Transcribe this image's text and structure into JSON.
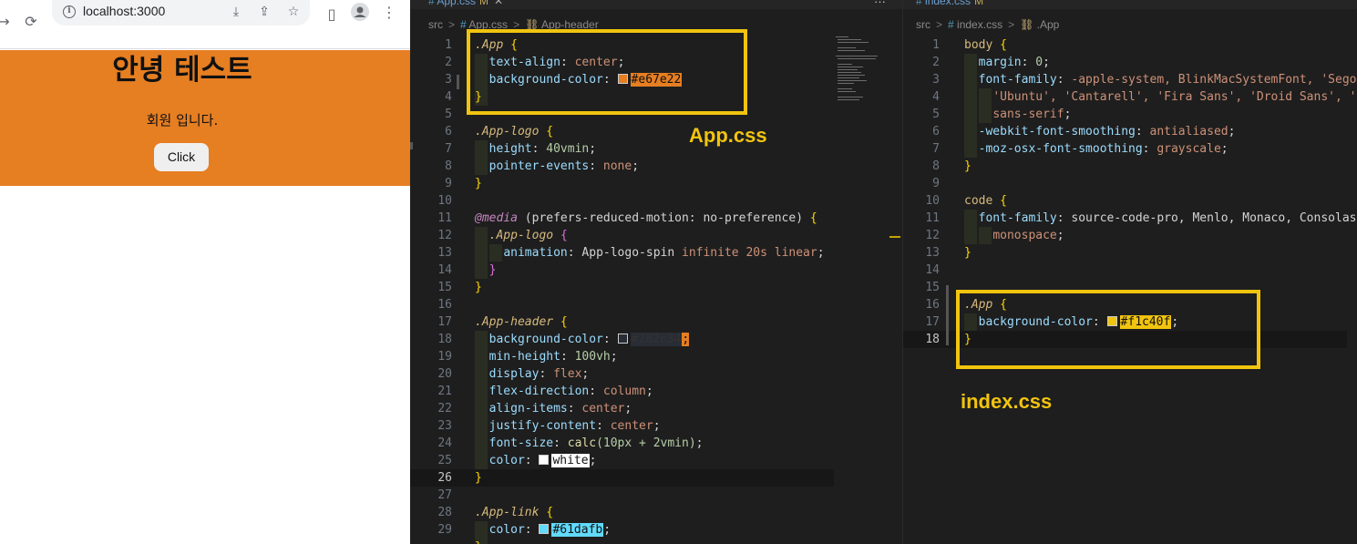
{
  "browser": {
    "url": "localhost:3000",
    "title": "안녕 테스트",
    "subtitle": "회원 입니다.",
    "button_label": "Click",
    "header_bg": "#e67e22"
  },
  "editor_left": {
    "tab": {
      "name": "App.css",
      "modified": "M"
    },
    "breadcrumb": [
      "src",
      "App.css",
      "App-header"
    ],
    "lines": [
      "1",
      "2",
      "3",
      "4",
      "5",
      "6",
      "7",
      "8",
      "9",
      "10",
      "11",
      "12",
      "13",
      "14",
      "15",
      "16",
      "17",
      "18",
      "19",
      "20",
      "21",
      "22",
      "23",
      "24",
      "25",
      "26",
      "27",
      "28",
      "29"
    ],
    "code": {
      "l1_sel": ".App",
      "l1_brace": "{",
      "l2_prop": "text-align",
      "l2_val": "center",
      "l3_prop": "background-color",
      "l3_val": "#e67e22",
      "l4_brace": "}",
      "l6_sel": ".App-logo",
      "l6_brace": "{",
      "l7_prop": "height",
      "l7_val": "40vmin",
      "l8_prop": "pointer-events",
      "l8_val": "none",
      "l9_brace": "}",
      "l11_at": "@media",
      "l11_rest": "(prefers-reduced-motion: no-preference)",
      "l11_brace": "{",
      "l12_sel": ".App-logo",
      "l12_brace": "{",
      "l13_prop": "animation",
      "l13_name": "App-logo-spin",
      "l13_val": "infinite 20s linear",
      "l14_brace": "}",
      "l15_brace": "}",
      "l17_sel": ".App-header",
      "l17_brace": "{",
      "l18_prop": "background-color",
      "l18_val": "#282c34",
      "l19_prop": "min-height",
      "l19_val": "100vh",
      "l20_prop": "display",
      "l20_val": "flex",
      "l21_prop": "flex-direction",
      "l21_val": "column",
      "l22_prop": "align-items",
      "l22_val": "center",
      "l23_prop": "justify-content",
      "l23_val": "center",
      "l24_prop": "font-size",
      "l24_fn": "calc",
      "l24_val": "(10px + 2vmin)",
      "l25_prop": "color",
      "l25_val": "white",
      "l26_brace": "}",
      "l28_sel": ".App-link",
      "l28_brace": "{",
      "l29_prop": "color",
      "l29_val": "#61dafb"
    },
    "annotation_label": "App.css"
  },
  "editor_right": {
    "tab": {
      "name": "index.css",
      "modified": "M"
    },
    "breadcrumb": [
      "src",
      "index.css",
      ".App"
    ],
    "lines": [
      "1",
      "2",
      "3",
      "4",
      "5",
      "6",
      "7",
      "8",
      "9",
      "10",
      "11",
      "12",
      "13",
      "14",
      "15",
      "16",
      "17",
      "18"
    ],
    "code": {
      "l1_sel": "body",
      "l1_brace": "{",
      "l2_prop": "margin",
      "l2_val": "0",
      "l3_prop": "font-family",
      "l3_val": "-apple-system, BlinkMacSystemFont, 'Sego",
      "l4_val": "'Ubuntu', 'Cantarell', 'Fira Sans', 'Droid Sans', '",
      "l5_val": "sans-serif",
      "l6_prop": "-webkit-font-smoothing",
      "l6_val": "antialiased",
      "l7_prop": "-moz-osx-font-smoothing",
      "l7_val": "grayscale",
      "l8_brace": "}",
      "l10_sel": "code",
      "l10_brace": "{",
      "l11_prop": "font-family",
      "l11_val": "source-code-pro, Menlo, Monaco, Consolas",
      "l12_val": "monospace",
      "l13_brace": "}",
      "l16_sel": ".App",
      "l16_brace": "{",
      "l17_prop": "background-color",
      "l17_val": "#f1c40f",
      "l18_brace": "}"
    },
    "annotation_label": "index.css"
  },
  "colors": {
    "annotation": "#f1c40f",
    "swatch_orange": "#e67e22",
    "swatch_dark": "#282c34",
    "swatch_white": "#ffffff",
    "swatch_cyan": "#61dafb",
    "swatch_yellow": "#f1c40f"
  }
}
